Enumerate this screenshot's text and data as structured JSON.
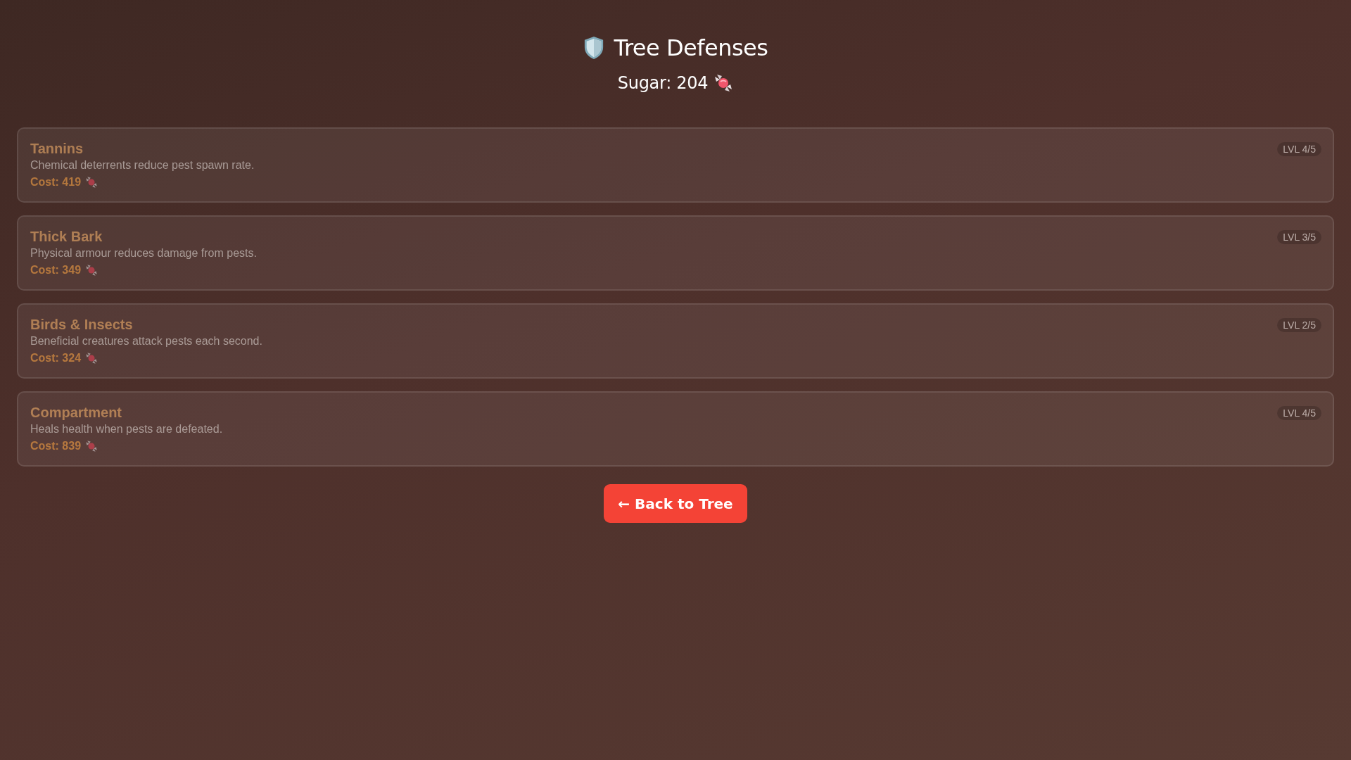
{
  "header": {
    "title": "Tree Defenses",
    "sugar": "Sugar: 204"
  },
  "upgrades": [
    {
      "name": "Tannins",
      "description": "Chemical deterrents reduce pest spawn rate.",
      "cost": "Cost: 419",
      "level": "LVL 4/5",
      "affordable": false
    },
    {
      "name": "Thick Bark",
      "description": "Physical armour reduces damage from pests.",
      "cost": "Cost: 349",
      "level": "LVL 3/5",
      "affordable": false
    },
    {
      "name": "Birds & Insects",
      "description": "Beneficial creatures attack pests each second.",
      "cost": "Cost: 324",
      "level": "LVL 2/5",
      "affordable": false
    },
    {
      "name": "Compartment",
      "description": "Heals health when pests are defeated.",
      "cost": "Cost: 839",
      "level": "LVL 4/5",
      "affordable": false
    }
  ],
  "back_button": "← Back to Tree"
}
